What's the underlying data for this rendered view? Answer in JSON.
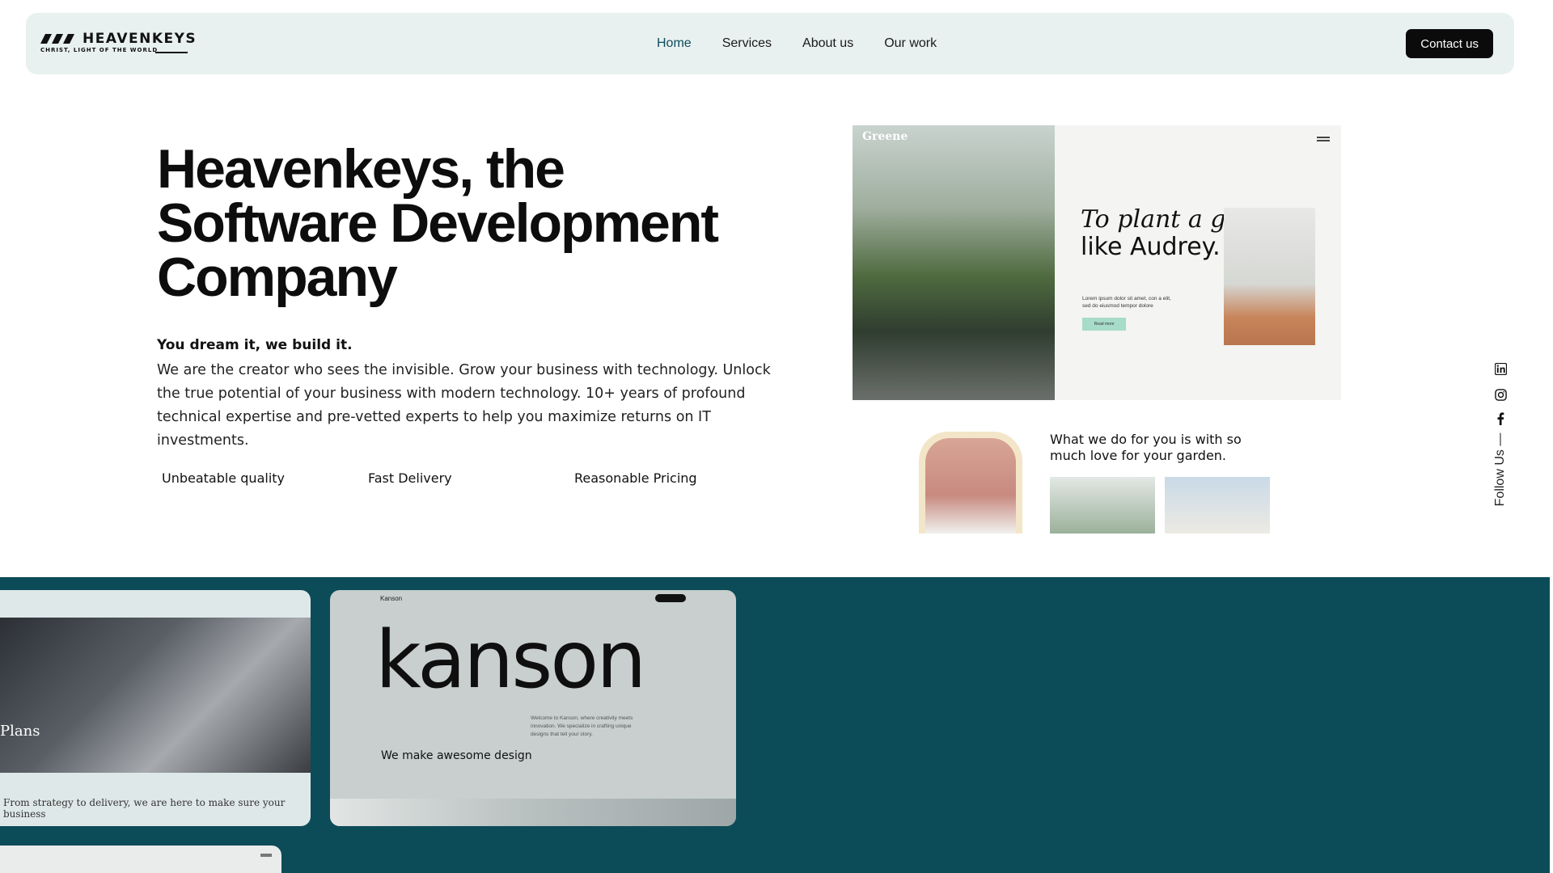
{
  "nav": {
    "brand": "HEAVENKEYS",
    "tagline": "CHRIST, LIGHT OF THE WORLD",
    "links": [
      {
        "label": "Home",
        "active": true
      },
      {
        "label": "Services",
        "active": false
      },
      {
        "label": "About us",
        "active": false
      },
      {
        "label": "Our work",
        "active": false
      }
    ],
    "contact_label": "Contact us"
  },
  "hero": {
    "title_lines": [
      "Heavenkeys, the",
      "Software Development",
      "Company"
    ],
    "subtitle": "You dream it, we build it.",
    "description": "We are the creator who sees the invisible. Grow your business with technology. Unlock the true potential of your business with modern technology. 10+ years of profound technical expertise and pre-vetted experts to help you maximize returns on IT investments.",
    "features": [
      "Unbeatable quality",
      "Fast Delivery",
      "Reasonable Pricing"
    ]
  },
  "showcase": {
    "card1": {
      "brand": "Greene",
      "title_italic": "To plant a garden",
      "title_plain": "like Audrey.",
      "text": "Lorem ipsum dolor sit amet, con a elit, sed do eiusmod tempor dolore",
      "button": "Read more"
    },
    "card2": {
      "title": "What we do for you is with so much love for your garden."
    }
  },
  "follow": {
    "label": "Follow Us —",
    "icons": [
      "linkedin-icon",
      "instagram-icon",
      "facebook-icon"
    ]
  },
  "portfolio": {
    "card1": {
      "plans": "Plans",
      "text": "From strategy to delivery, we are here to make sure your business"
    },
    "card2": {
      "brand": "Kanson",
      "big": "kanson",
      "small": "Welcome to Kanson, where creativity meets innovation. We specialize in crafting unique designs that tell your story.",
      "make": "We make awesome design"
    }
  },
  "colors": {
    "accent": "#0c4c58",
    "nav_bg": "#e9f0f0",
    "button_bg": "#0b0b0b"
  }
}
